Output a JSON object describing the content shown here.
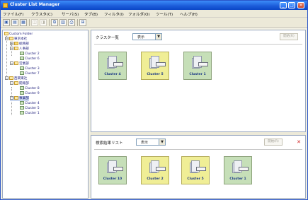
{
  "window": {
    "title": "Cluster List Manager",
    "controls": {
      "minimize": "_",
      "maximize": "□",
      "close": "×"
    }
  },
  "menu": [
    "ファイル(F)",
    "クラスタ(C)",
    "サーバ(S)",
    "タブ(B)",
    "フィルタ(I)",
    "フォルダ(O)",
    "ツール(T)",
    "ヘルプ(H)"
  ],
  "toolbar": [
    "new-icon",
    "view-icon",
    "grid-icon",
    "disabled-a-icon",
    "disabled-b-icon",
    "copy-icon",
    "paste-icon",
    "print-icon",
    "settings-icon"
  ],
  "tree": {
    "root": "Custom Folder",
    "nodes": [
      {
        "label": "東京本社"
      },
      {
        "label": "総務部"
      },
      {
        "label": "人事部"
      },
      {
        "label": "Cluster 2"
      },
      {
        "label": "Cluster 6"
      },
      {
        "label": "営業部"
      },
      {
        "label": "Cluster 3"
      },
      {
        "label": "Cluster 7"
      },
      {
        "label": "西関東社"
      },
      {
        "label": "開発部"
      },
      {
        "label": "Cluster 8"
      },
      {
        "label": "Cluster 9"
      },
      {
        "label": "事業部"
      },
      {
        "label": "Cluster 4"
      },
      {
        "label": "Cluster 5"
      },
      {
        "label": "Cluster 1"
      }
    ]
  },
  "cluster_list": {
    "title": "クラスター覧",
    "view_value": "表示",
    "action_label": "開始(R)",
    "tiles": [
      {
        "label": "Cluster 4",
        "tag": "unknown"
      },
      {
        "label": "Cluster 5",
        "tag": "offline"
      },
      {
        "label": "Cluster 1",
        "tag": "online"
      }
    ]
  },
  "search_results": {
    "title": "検索結果リスト",
    "view_value": "表示",
    "action_label": "開始(R)",
    "tiles": [
      {
        "label": "Cluster 10",
        "tag": "online"
      },
      {
        "label": "Cluster 2",
        "tag": "offline"
      },
      {
        "label": "Cluster 5",
        "tag": "offline"
      },
      {
        "label": "Cluster 1",
        "tag": "online"
      }
    ]
  },
  "colors": {
    "titlebar": "#1a5ad8",
    "tile_green": "#c6dfb8",
    "tile_yellow": "#f0ee96",
    "label_blue": "#1c3a86",
    "close_red": "#d02020"
  }
}
